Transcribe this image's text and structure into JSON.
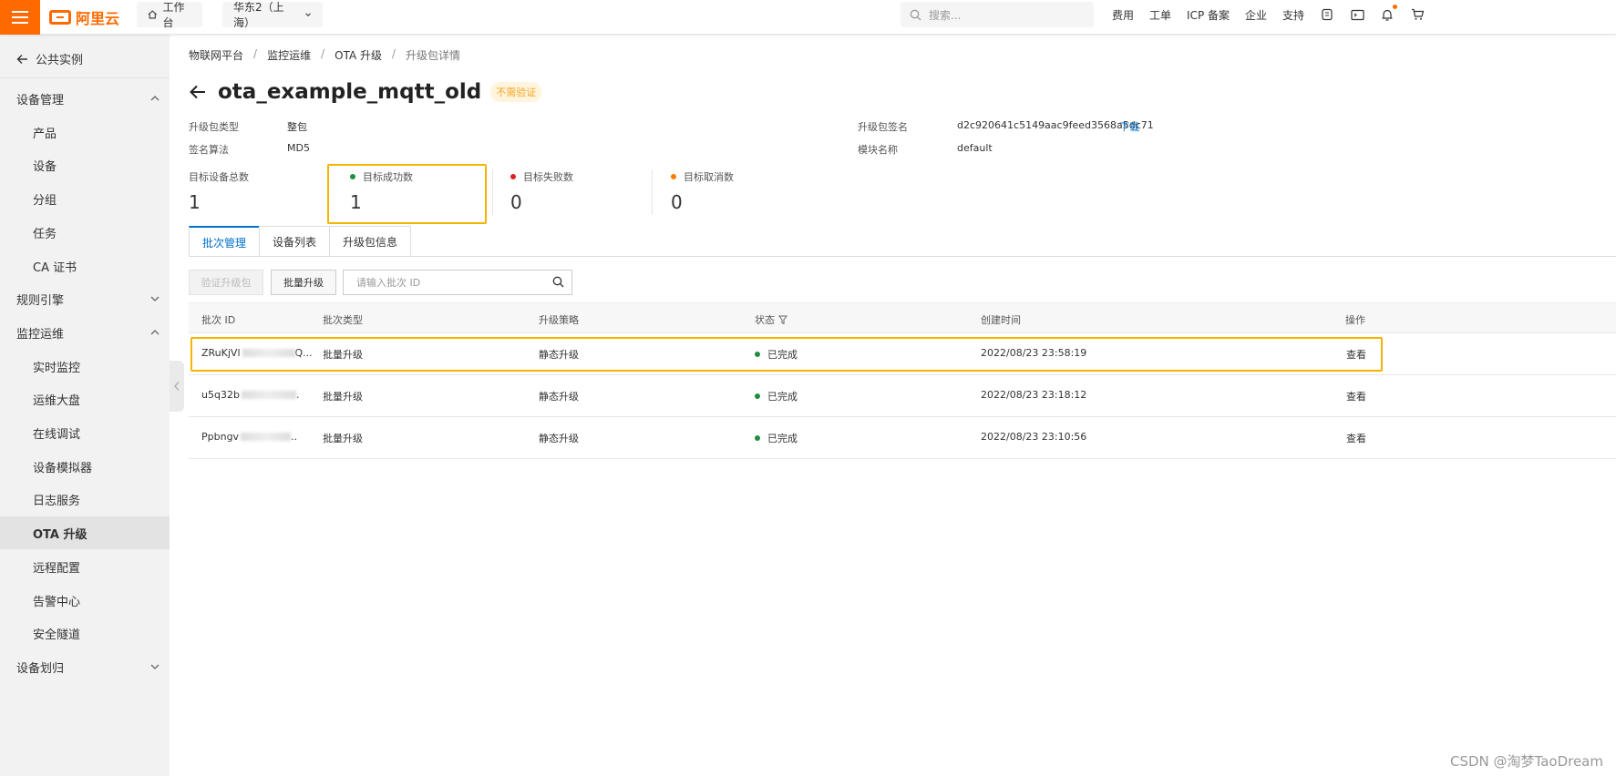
{
  "topbar": {
    "logo_text": "阿里云",
    "workbench": "工作台",
    "region": "华东2（上海）",
    "search_placeholder": "搜索...",
    "nav": [
      "费用",
      "工单",
      "ICP 备案",
      "企业",
      "支持"
    ]
  },
  "sidebar": {
    "back_label": "公共实例",
    "items": [
      {
        "label": "设备管理",
        "kind": "group",
        "expanded": true
      },
      {
        "label": "产品",
        "kind": "sub"
      },
      {
        "label": "设备",
        "kind": "sub"
      },
      {
        "label": "分组",
        "kind": "sub"
      },
      {
        "label": "任务",
        "kind": "sub"
      },
      {
        "label": "CA 证书",
        "kind": "sub"
      },
      {
        "label": "规则引擎",
        "kind": "group",
        "expanded": false
      },
      {
        "label": "监控运维",
        "kind": "group",
        "expanded": true
      },
      {
        "label": "实时监控",
        "kind": "sub"
      },
      {
        "label": "运维大盘",
        "kind": "sub"
      },
      {
        "label": "在线调试",
        "kind": "sub"
      },
      {
        "label": "设备模拟器",
        "kind": "sub"
      },
      {
        "label": "日志服务",
        "kind": "sub"
      },
      {
        "label": "OTA 升级",
        "kind": "sub",
        "active": true
      },
      {
        "label": "远程配置",
        "kind": "sub"
      },
      {
        "label": "告警中心",
        "kind": "sub"
      },
      {
        "label": "安全隧道",
        "kind": "sub"
      },
      {
        "label": "设备划归",
        "kind": "group",
        "expanded": false
      }
    ]
  },
  "breadcrumb": [
    "物联网平台",
    "监控运维",
    "OTA 升级",
    "升级包详情"
  ],
  "page": {
    "title": "ota_example_mqtt_old",
    "tag": "不需验证"
  },
  "meta": {
    "type_label": "升级包类型",
    "type_value": "整包",
    "algo_label": "签名算法",
    "algo_value": "MD5",
    "sign_label": "升级包签名",
    "sign_value": "d2c920641c5149aac9feed3568a5dc71",
    "download": "下载",
    "module_label": "模块名称",
    "module_value": "default"
  },
  "stats": [
    {
      "label": "目标设备总数",
      "value": "1",
      "dot": ""
    },
    {
      "label": "目标成功数",
      "value": "1",
      "dot": "#1e8e3e"
    },
    {
      "label": "目标失败数",
      "value": "0",
      "dot": "#e02020"
    },
    {
      "label": "目标取消数",
      "value": "0",
      "dot": "#ff7a00"
    }
  ],
  "tabs": [
    "批次管理",
    "设备列表",
    "升级包信息"
  ],
  "toolbar": {
    "verify": "验证升级包",
    "batch": "批量升级",
    "search_placeholder": "请输入批次 ID"
  },
  "table": {
    "headers": [
      "批次 ID",
      "批次类型",
      "升级策略",
      "状态",
      "创建时间",
      "操作"
    ],
    "rows": [
      {
        "id": "ZRuKjVl",
        "id_tail": "Q...",
        "type": "批量升级",
        "strategy": "静态升级",
        "status": "已完成",
        "time": "2022/08/23 23:58:19",
        "action": "查看"
      },
      {
        "id": "u5q32b",
        "id_tail": ".",
        "type": "批量升级",
        "strategy": "静态升级",
        "status": "已完成",
        "time": "2022/08/23 23:18:12",
        "action": "查看"
      },
      {
        "id": "Ppbngv",
        "id_tail": "..",
        "type": "批量升级",
        "strategy": "静态升级",
        "status": "已完成",
        "time": "2022/08/23 23:10:56",
        "action": "查看"
      }
    ]
  },
  "watermark": "CSDN @淘梦TaoDream",
  "colors": {
    "brand": "#ff6a00",
    "link": "#0070cc",
    "highlight": "#f5b400",
    "success": "#1e8e3e"
  }
}
